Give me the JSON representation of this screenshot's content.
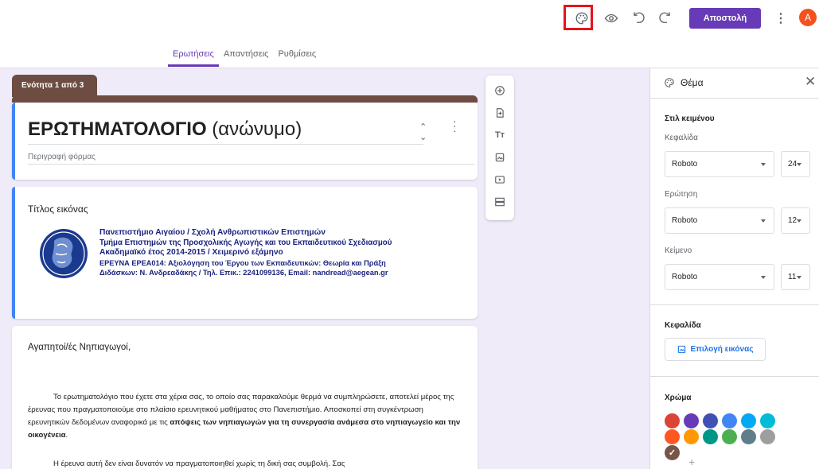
{
  "tabs": [
    "Ερωτήσεις",
    "Απαντήσεις",
    "Ρυθμίσεις"
  ],
  "toolbar": {
    "send_label": "Αποστολή",
    "avatar_letter": "A"
  },
  "section": {
    "label": "Ενότητα 1 από 3"
  },
  "form": {
    "title_bold": "ΕΡΩΤΗΜΑΤΟΛΟΓΙΟ",
    "title_rest": " (ανώνυμο)",
    "description_placeholder": "Περιγραφή φόρμας"
  },
  "image_item": {
    "title": "Τίτλος εικόνας",
    "lines": [
      "Πανεπιστήμιο Αιγαίου / Σχολή Ανθρωπιστικών Επιστημών",
      "Τμήμα Επιστημών της Προσχολικής Αγωγής και του Εκπαιδευτικού Σχεδιασμού",
      "Ακαδημαϊκό έτος 2014-2015 / Χειμερινό εξάμηνο",
      "ΕΡΕΥΝΑ ΕΡΕΑ014: Αξιολόγηση του Έργου των Εκπαιδευτικών: Θεωρία και Πράξη",
      "Διδάσκων: Ν. Ανδρεαδάκης / Τηλ. Επικ.: 2241099136, Email: nandread@aegean.gr"
    ]
  },
  "text_item": {
    "greeting": "Αγαπητοί/ές Νηπιαγωγοί,",
    "para1_a": "Το ερωτηματολόγιο που έχετε στα χέρια σας, το οποίο σας παρακαλούμε θερμά να συμπληρώσετε, αποτελεί μέρος της έρευνας που πραγματοποιούμε στο πλαίσιο ερευνητικού μαθήματος στο Πανεπιστήμιο. Αποσκοπεί στη συγκέντρωση ερευνητικών δεδομένων αναφορικά με τις ",
    "para1_bold": "απόψεις των νηπιαγωγών για τη συνεργασία ανάμεσα στο νηπιαγωγείο και την οικογένεια",
    "para1_end": ".",
    "para2": "Η έρευνα αυτή δεν είναι δυνατόν να πραγματοποιηθεί χωρίς τη δική σας συμβολή. Σας"
  },
  "theme_panel": {
    "title": "Θέμα",
    "text_style_heading": "Στιλ κειμένου",
    "header_label": "Κεφαλίδα",
    "header_font": "Roboto",
    "header_size": "24",
    "question_label": "Ερώτηση",
    "question_font": "Roboto",
    "question_size": "12",
    "text_label": "Κείμενο",
    "text_font": "Roboto",
    "text_size": "11",
    "header_image_heading": "Κεφαλίδα",
    "choose_image_label": "Επιλογή εικόνας",
    "color_heading": "Χρώμα",
    "colors": [
      "#db4437",
      "#673ab7",
      "#3f51b5",
      "#4285f4",
      "#03a9f4",
      "#00bcd4",
      "#ff5722",
      "#ff9800",
      "#009688",
      "#4caf50",
      "#607d8b",
      "#9e9e9e",
      "#795548"
    ],
    "selected_color": "#795548",
    "check_mark": "✓",
    "add_mark": "+"
  },
  "colors": {
    "accent": "#673ab7",
    "section": "#6d4c41",
    "link": "#1a73e8"
  }
}
